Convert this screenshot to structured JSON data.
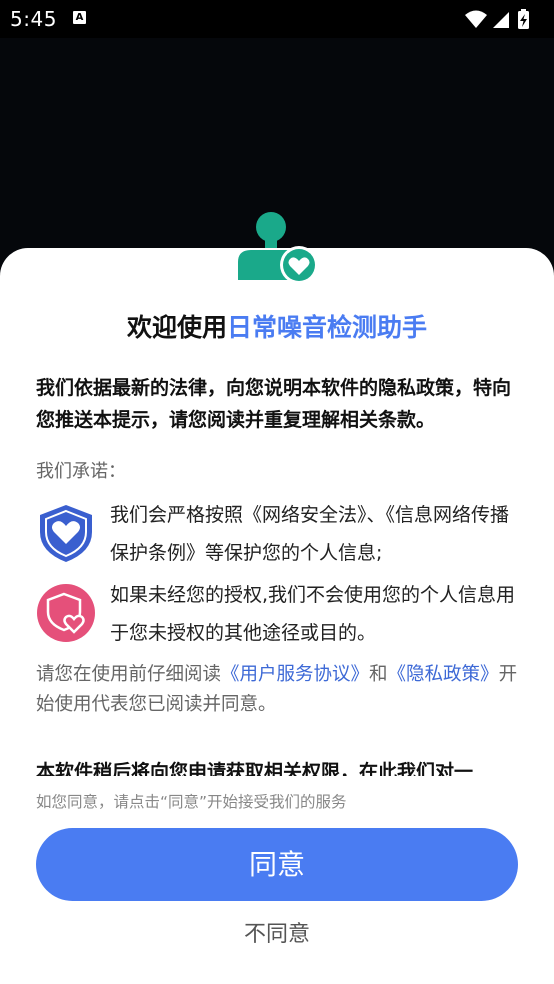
{
  "status_bar": {
    "time": "5:45",
    "a_badge": "A",
    "icons": [
      "notification-a-icon",
      "wifi-icon",
      "signal-icon",
      "battery-charging-icon"
    ]
  },
  "dialog": {
    "title_prefix": "欢迎使用",
    "app_name": "日常噪音检测助手",
    "intro": "我们依据最新的法律，向您说明本软件的隐私政策，特向您推送本提示，请您阅读并重复理解相关条款。",
    "promise_label": "我们承诺：",
    "promises": [
      {
        "icon": "shield-heart-icon",
        "text": "我们会严格按照《网络安全法》、《信息网络传播保护条例》等保护您的个人信息;"
      },
      {
        "icon": "shield-heart-circle-icon",
        "text": "如果未经您的授权,我们不会使用您的个人信息用于您未授权的其他途径或目的。"
      }
    ],
    "read_notice": {
      "before": "请您在使用前仔细阅读",
      "user_agreement": "《用户服务协议》",
      "and": "和",
      "privacy_policy": "《隐私政策》",
      "after": "开始使用代表您已阅读并同意。"
    },
    "permission_text": "本软件稍后将向您申请获取相关权限，在此我们对一",
    "hint": "如您同意，请点击“同意”开始接受我们的服务",
    "agree_label": "同意",
    "disagree_label": "不同意"
  },
  "colors": {
    "accent": "#4a7cf2",
    "logo_green": "#1aa98a",
    "shield_blue": "#3a5fcf",
    "badge_pink": "#e5507a",
    "link": "#3d69d6"
  }
}
